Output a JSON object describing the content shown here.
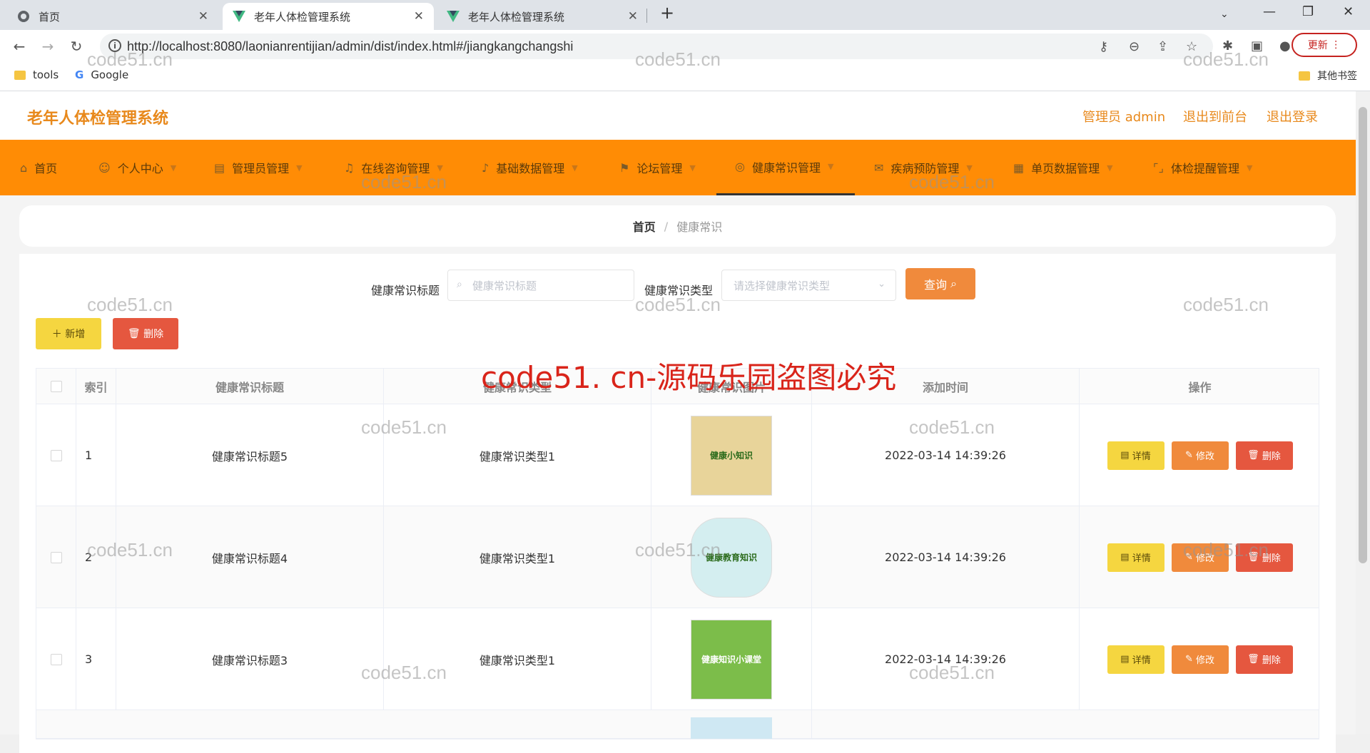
{
  "browser": {
    "tabs": [
      {
        "title": "首页",
        "active": false
      },
      {
        "title": "老年人体检管理系统",
        "active": true
      },
      {
        "title": "老年人体检管理系统",
        "active": false
      }
    ],
    "url": "http://localhost:8080/laonianrentijian/admin/dist/index.html#/jiangkangchangshi",
    "update_label": "更新",
    "bookmarks": [
      {
        "label": "tools"
      },
      {
        "label": "Google"
      }
    ],
    "other_bookmarks": "其他书签"
  },
  "app": {
    "title": "老年人体检管理系统",
    "admin_label": "管理员 admin",
    "exit_front": "退出到前台",
    "logout": "退出登录"
  },
  "nav": [
    {
      "label": "首页",
      "icon": "home-icon"
    },
    {
      "label": "个人中心",
      "icon": "user-icon"
    },
    {
      "label": "管理员管理",
      "icon": "book-icon"
    },
    {
      "label": "在线咨询管理",
      "icon": "bell-icon"
    },
    {
      "label": "基础数据管理",
      "icon": "mic-icon"
    },
    {
      "label": "论坛管理",
      "icon": "flag-icon"
    },
    {
      "label": "健康常识管理",
      "icon": "compass-icon",
      "active": true
    },
    {
      "label": "疾病预防管理",
      "icon": "mail-icon"
    },
    {
      "label": "单页数据管理",
      "icon": "doc-icon"
    },
    {
      "label": "体检提醒管理",
      "icon": "frame-icon"
    }
  ],
  "breadcrumb": {
    "home": "首页",
    "current": "健康常识"
  },
  "search": {
    "title_label": "健康常识标题",
    "title_placeholder": "健康常识标题",
    "type_label": "健康常识类型",
    "type_placeholder": "请选择健康常识类型",
    "query_label": "查询"
  },
  "actions": {
    "add": "新增",
    "delete": "删除"
  },
  "table": {
    "headers": [
      "索引",
      "健康常识标题",
      "健康常识类型",
      "健康常识图片",
      "添加时间",
      "操作"
    ],
    "rows": [
      {
        "index": "1",
        "title": "健康常识标题5",
        "type": "健康常识类型1",
        "image": "健康小知识",
        "time": "2022-03-14 14:39:26"
      },
      {
        "index": "2",
        "title": "健康常识标题4",
        "type": "健康常识类型1",
        "image": "健康教育知识",
        "time": "2022-03-14 14:39:26"
      },
      {
        "index": "3",
        "title": "健康常识标题3",
        "type": "健康常识类型1",
        "image": "健康知识小课堂",
        "time": "2022-03-14 14:39:26"
      }
    ],
    "op_detail": "详情",
    "op_edit": "修改",
    "op_delete": "删除"
  },
  "watermark": {
    "small": "code51.cn",
    "big": "code51. cn-源码乐园盗图必究"
  }
}
